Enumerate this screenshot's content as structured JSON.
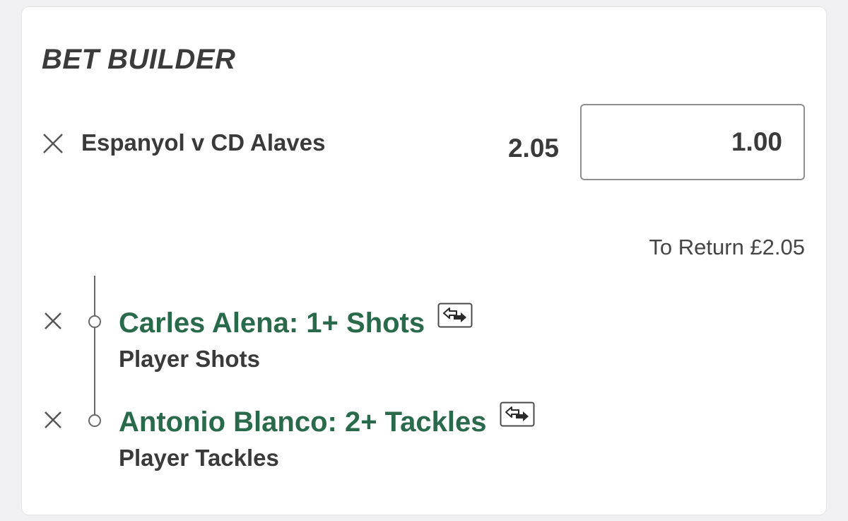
{
  "bet_builder": {
    "title": "BET BUILDER",
    "event": {
      "name": "Espanyol v CD Alaves",
      "odds": "2.05",
      "stake": "1.00"
    },
    "to_return": "To Return £2.05",
    "selections": [
      {
        "name": "Carles Alena: 1+ Shots",
        "market": "Player Shots",
        "icon": "swap-icon"
      },
      {
        "name": "Antonio Blanco: 2+ Tackles",
        "market": "Player Tackles",
        "icon": "swap-icon"
      }
    ]
  },
  "colors": {
    "selection_green": "#2a6a4c",
    "text_dark": "#3a3a3a",
    "card_background": "#ffffff",
    "page_background": "#f0f0f2"
  }
}
